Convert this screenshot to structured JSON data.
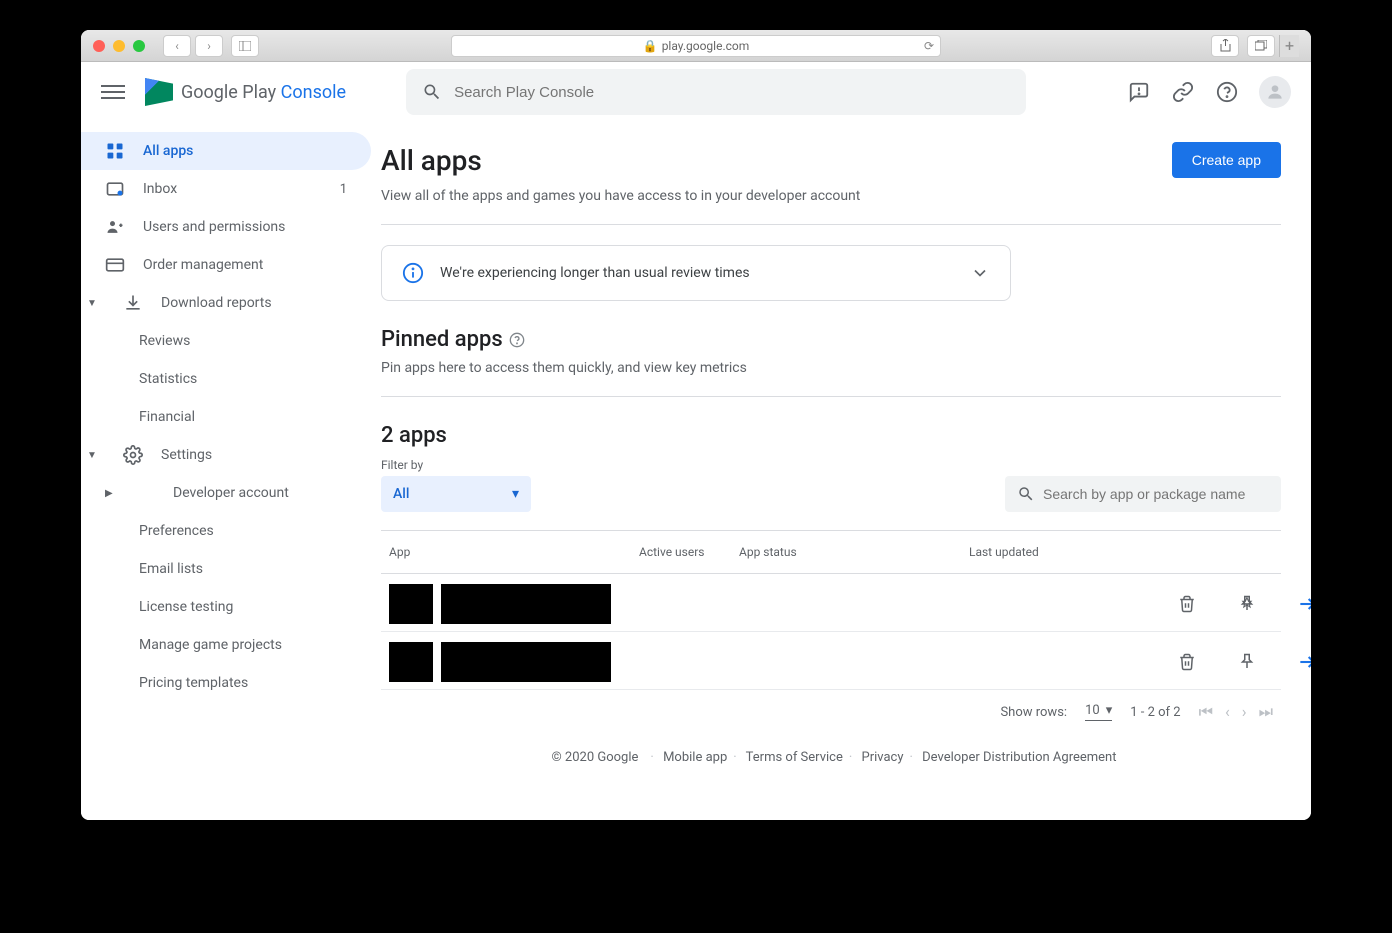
{
  "browser": {
    "url": "play.google.com"
  },
  "logo": {
    "text1": "Google Play ",
    "text2": "Console"
  },
  "search": {
    "placeholder": "Search Play Console"
  },
  "sidebar": {
    "allapps": "All apps",
    "inbox": "Inbox",
    "inbox_badge": "1",
    "users": "Users and permissions",
    "orders": "Order management",
    "download": "Download reports",
    "reviews": "Reviews",
    "statistics": "Statistics",
    "financial": "Financial",
    "settings": "Settings",
    "devaccount": "Developer account",
    "preferences": "Preferences",
    "emaillists": "Email lists",
    "license": "License testing",
    "gameprojects": "Manage game projects",
    "pricing": "Pricing templates"
  },
  "page": {
    "title": "All apps",
    "subtitle": "View all of the apps and games you have access to in your developer account",
    "create_btn": "Create app",
    "notice": "We're experiencing longer than usual review times",
    "pinned_title": "Pinned apps",
    "pinned_sub": "Pin apps here to access them quickly, and view key metrics",
    "apps_title": "2 apps",
    "filter_label": "Filter by",
    "filter_value": "All",
    "app_search_placeholder": "Search by app or package name",
    "thead": {
      "app": "App",
      "active": "Active users",
      "status": "App status",
      "updated": "Last updated"
    },
    "pager": {
      "showrows": "Show rows:",
      "rows": "10",
      "range": "1 - 2 of 2"
    }
  },
  "footer": {
    "copyright": "© 2020 Google",
    "mobile": "Mobile app",
    "tos": "Terms of Service",
    "privacy": "Privacy",
    "dda": "Developer Distribution Agreement"
  }
}
